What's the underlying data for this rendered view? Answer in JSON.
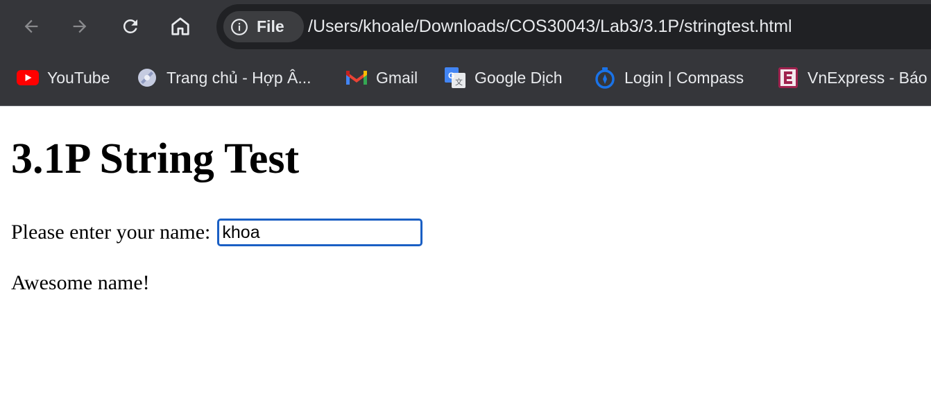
{
  "browser": {
    "site_chip_label": "File",
    "url": "/Users/khoale/Downloads/COS30043/Lab3/3.1P/stringtest.html",
    "bookmarks": [
      {
        "label": "YouTube",
        "icon": "youtube-icon"
      },
      {
        "label": "Trang chủ - Hợp Â...",
        "icon": "site-favicon-icon"
      },
      {
        "label": "Gmail",
        "icon": "gmail-icon"
      },
      {
        "label": "Google Dịch",
        "icon": "google-translate-icon"
      },
      {
        "label": "Login | Compass",
        "icon": "compass-icon"
      },
      {
        "label": "VnExpress - Báo",
        "icon": "vnexpress-icon"
      }
    ]
  },
  "page": {
    "heading": "3.1P String Test",
    "prompt_label": "Please enter your name:",
    "name_value": "khoa",
    "result_text": "Awesome name!"
  },
  "colors": {
    "chrome_bg": "#35363a",
    "omnibox_bg": "#202124",
    "input_focus": "#1a5fc4"
  }
}
